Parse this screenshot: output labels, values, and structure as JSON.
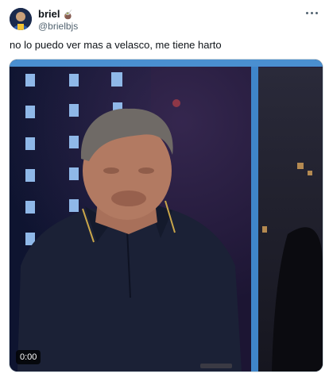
{
  "author": {
    "display_name": "briel",
    "name_emoji": "🧉",
    "handle": "@brielbjs"
  },
  "tweet": {
    "text": "no lo puedo ver mas a velasco, me tiene harto"
  },
  "media": {
    "type": "video",
    "timestamp": "0:00"
  },
  "colors": {
    "text": "#0f1419",
    "secondary_text": "#536471",
    "media_border": "#cfd9de"
  },
  "icons": {
    "more": "more-horizontal-icon"
  }
}
